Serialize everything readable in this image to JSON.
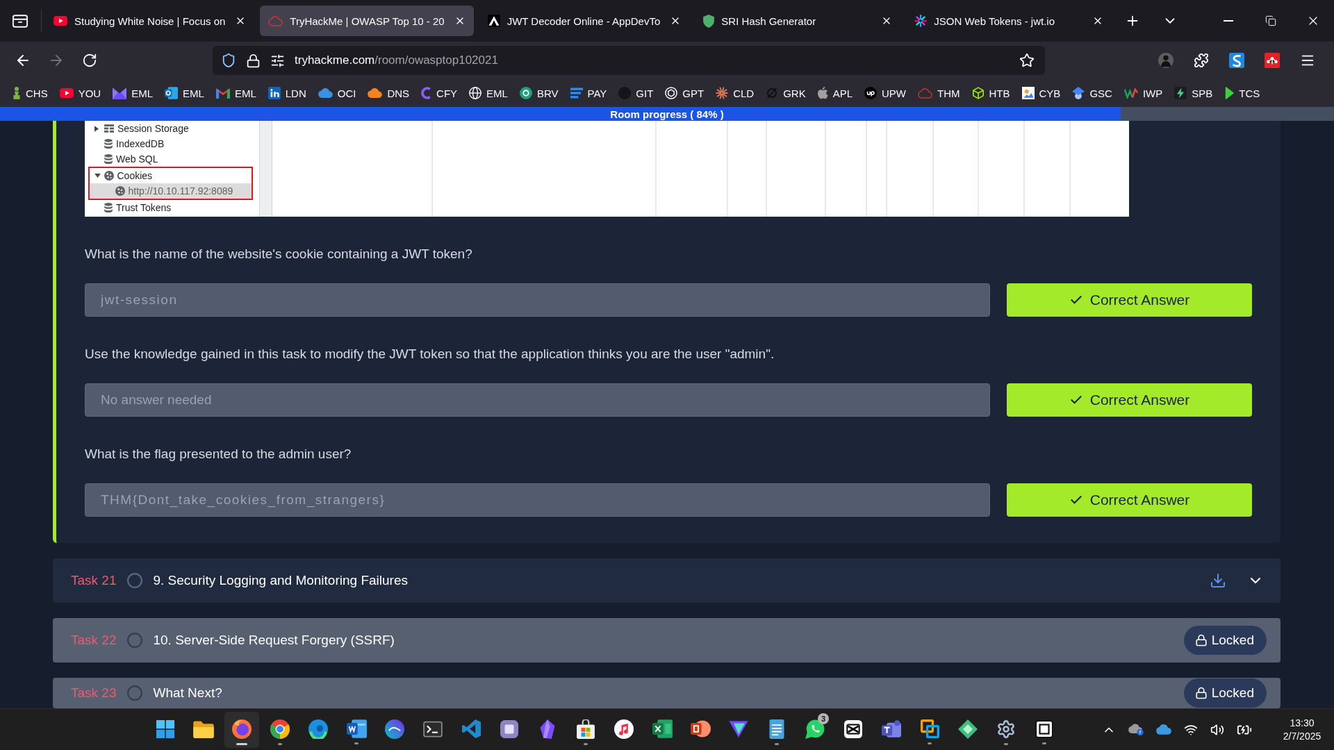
{
  "browser": {
    "tabs": [
      {
        "title": "Studying White Noise | Focus on",
        "selected": false
      },
      {
        "title": "TryHackMe | OWASP Top 10 - 20",
        "selected": true
      },
      {
        "title": "JWT Decoder Online - AppDevTo",
        "selected": false
      },
      {
        "title": "SRI Hash Generator",
        "selected": false
      },
      {
        "title": "JSON Web Tokens - jwt.io",
        "selected": false
      }
    ],
    "nav_buttons": [
      {
        "kind": "back",
        "disabled": false
      },
      {
        "kind": "forward",
        "disabled": true
      },
      {
        "kind": "reload",
        "disabled": false
      }
    ],
    "address": {
      "domain": "tryhackme.com",
      "path": "/room/owasptop102021"
    },
    "bookmarks": [
      "CHS",
      "YOU",
      "EML",
      "EML",
      "EML",
      "LDN",
      "OCI",
      "DNS",
      "CFY",
      "EML",
      "BRV",
      "PAY",
      "GIT",
      "GPT",
      "CLD",
      "GRK",
      "APL",
      "UPW",
      "THM",
      "HTB",
      "CYB",
      "GSC",
      "IWP",
      "SPB",
      "TCS"
    ]
  },
  "room_progress": {
    "label": "Room progress ( 84% )",
    "level": 0.84
  },
  "screenshot": {
    "tree": [
      {
        "label": "Session Storage",
        "kind": "grid",
        "expanded": false,
        "selected": false,
        "highlighted": false
      },
      {
        "label": "IndexedDB",
        "kind": "database",
        "selected": false,
        "highlighted": false
      },
      {
        "label": "Web SQL",
        "kind": "database",
        "selected": false,
        "highlighted": false
      },
      {
        "label": "Cookies",
        "kind": "cookie",
        "expanded": true,
        "selected": false,
        "highlighted": true,
        "children": [
          {
            "label": "http://10.10.117.92:8089",
            "kind": "cookie",
            "selected": true,
            "highlighted": false
          }
        ]
      },
      {
        "label": "Trust Tokens",
        "kind": "database",
        "selected": false,
        "highlighted": false
      }
    ]
  },
  "questions": [
    {
      "question": "What is the name of the website's cookie containing a JWT token?",
      "value": "jwt-session",
      "button": "Correct Answer",
      "correct": true
    },
    {
      "question": "Use the knowledge gained in this task to modify the JWT token so that the application thinks you are the user \"admin\".",
      "placeholder": "No answer needed",
      "button": "Correct Answer",
      "correct": true
    },
    {
      "question": "What is the flag presented to the admin user?",
      "value": "THM{Dont_take_cookies_from_strangers}",
      "button": "Correct Answer",
      "correct": true
    }
  ],
  "tasks": [
    {
      "number": "Task 21",
      "title": "9. Security Logging and Monitoring Failures",
      "done": false,
      "locked": false
    },
    {
      "number": "Task 22",
      "title": "10. Server-Side Request Forgery (SSRF)",
      "done": false,
      "locked": true,
      "badge": "Locked"
    },
    {
      "number": "Task 23",
      "title": "What Next?",
      "done": false,
      "locked": true,
      "badge": "Locked"
    }
  ],
  "taskbar": {
    "apps": [
      {
        "running": false,
        "selected": false
      },
      {
        "running": false,
        "selected": false
      },
      {
        "running": true,
        "selected": true
      },
      {
        "running": true,
        "selected": false
      },
      {
        "running": false,
        "selected": false
      },
      {
        "running": true,
        "selected": false
      },
      {
        "running": false,
        "selected": false
      },
      {
        "running": false,
        "selected": false
      },
      {
        "running": false,
        "selected": false
      },
      {
        "running": false,
        "selected": false
      },
      {
        "running": false,
        "selected": false
      },
      {
        "running": true,
        "selected": false
      },
      {
        "running": false,
        "selected": false
      },
      {
        "running": false,
        "selected": false
      },
      {
        "running": false,
        "selected": false
      },
      {
        "running": false,
        "selected": false
      },
      {
        "running": true,
        "selected": false
      },
      {
        "running": false,
        "selected": false,
        "badge": "3"
      },
      {
        "running": false,
        "selected": false
      },
      {
        "running": false,
        "selected": false
      },
      {
        "running": true,
        "selected": false
      },
      {
        "running": false,
        "selected": false
      },
      {
        "running": true,
        "selected": false
      },
      {
        "running": true,
        "selected": false
      }
    ],
    "time": "13:30",
    "date": "2/7/2025"
  }
}
